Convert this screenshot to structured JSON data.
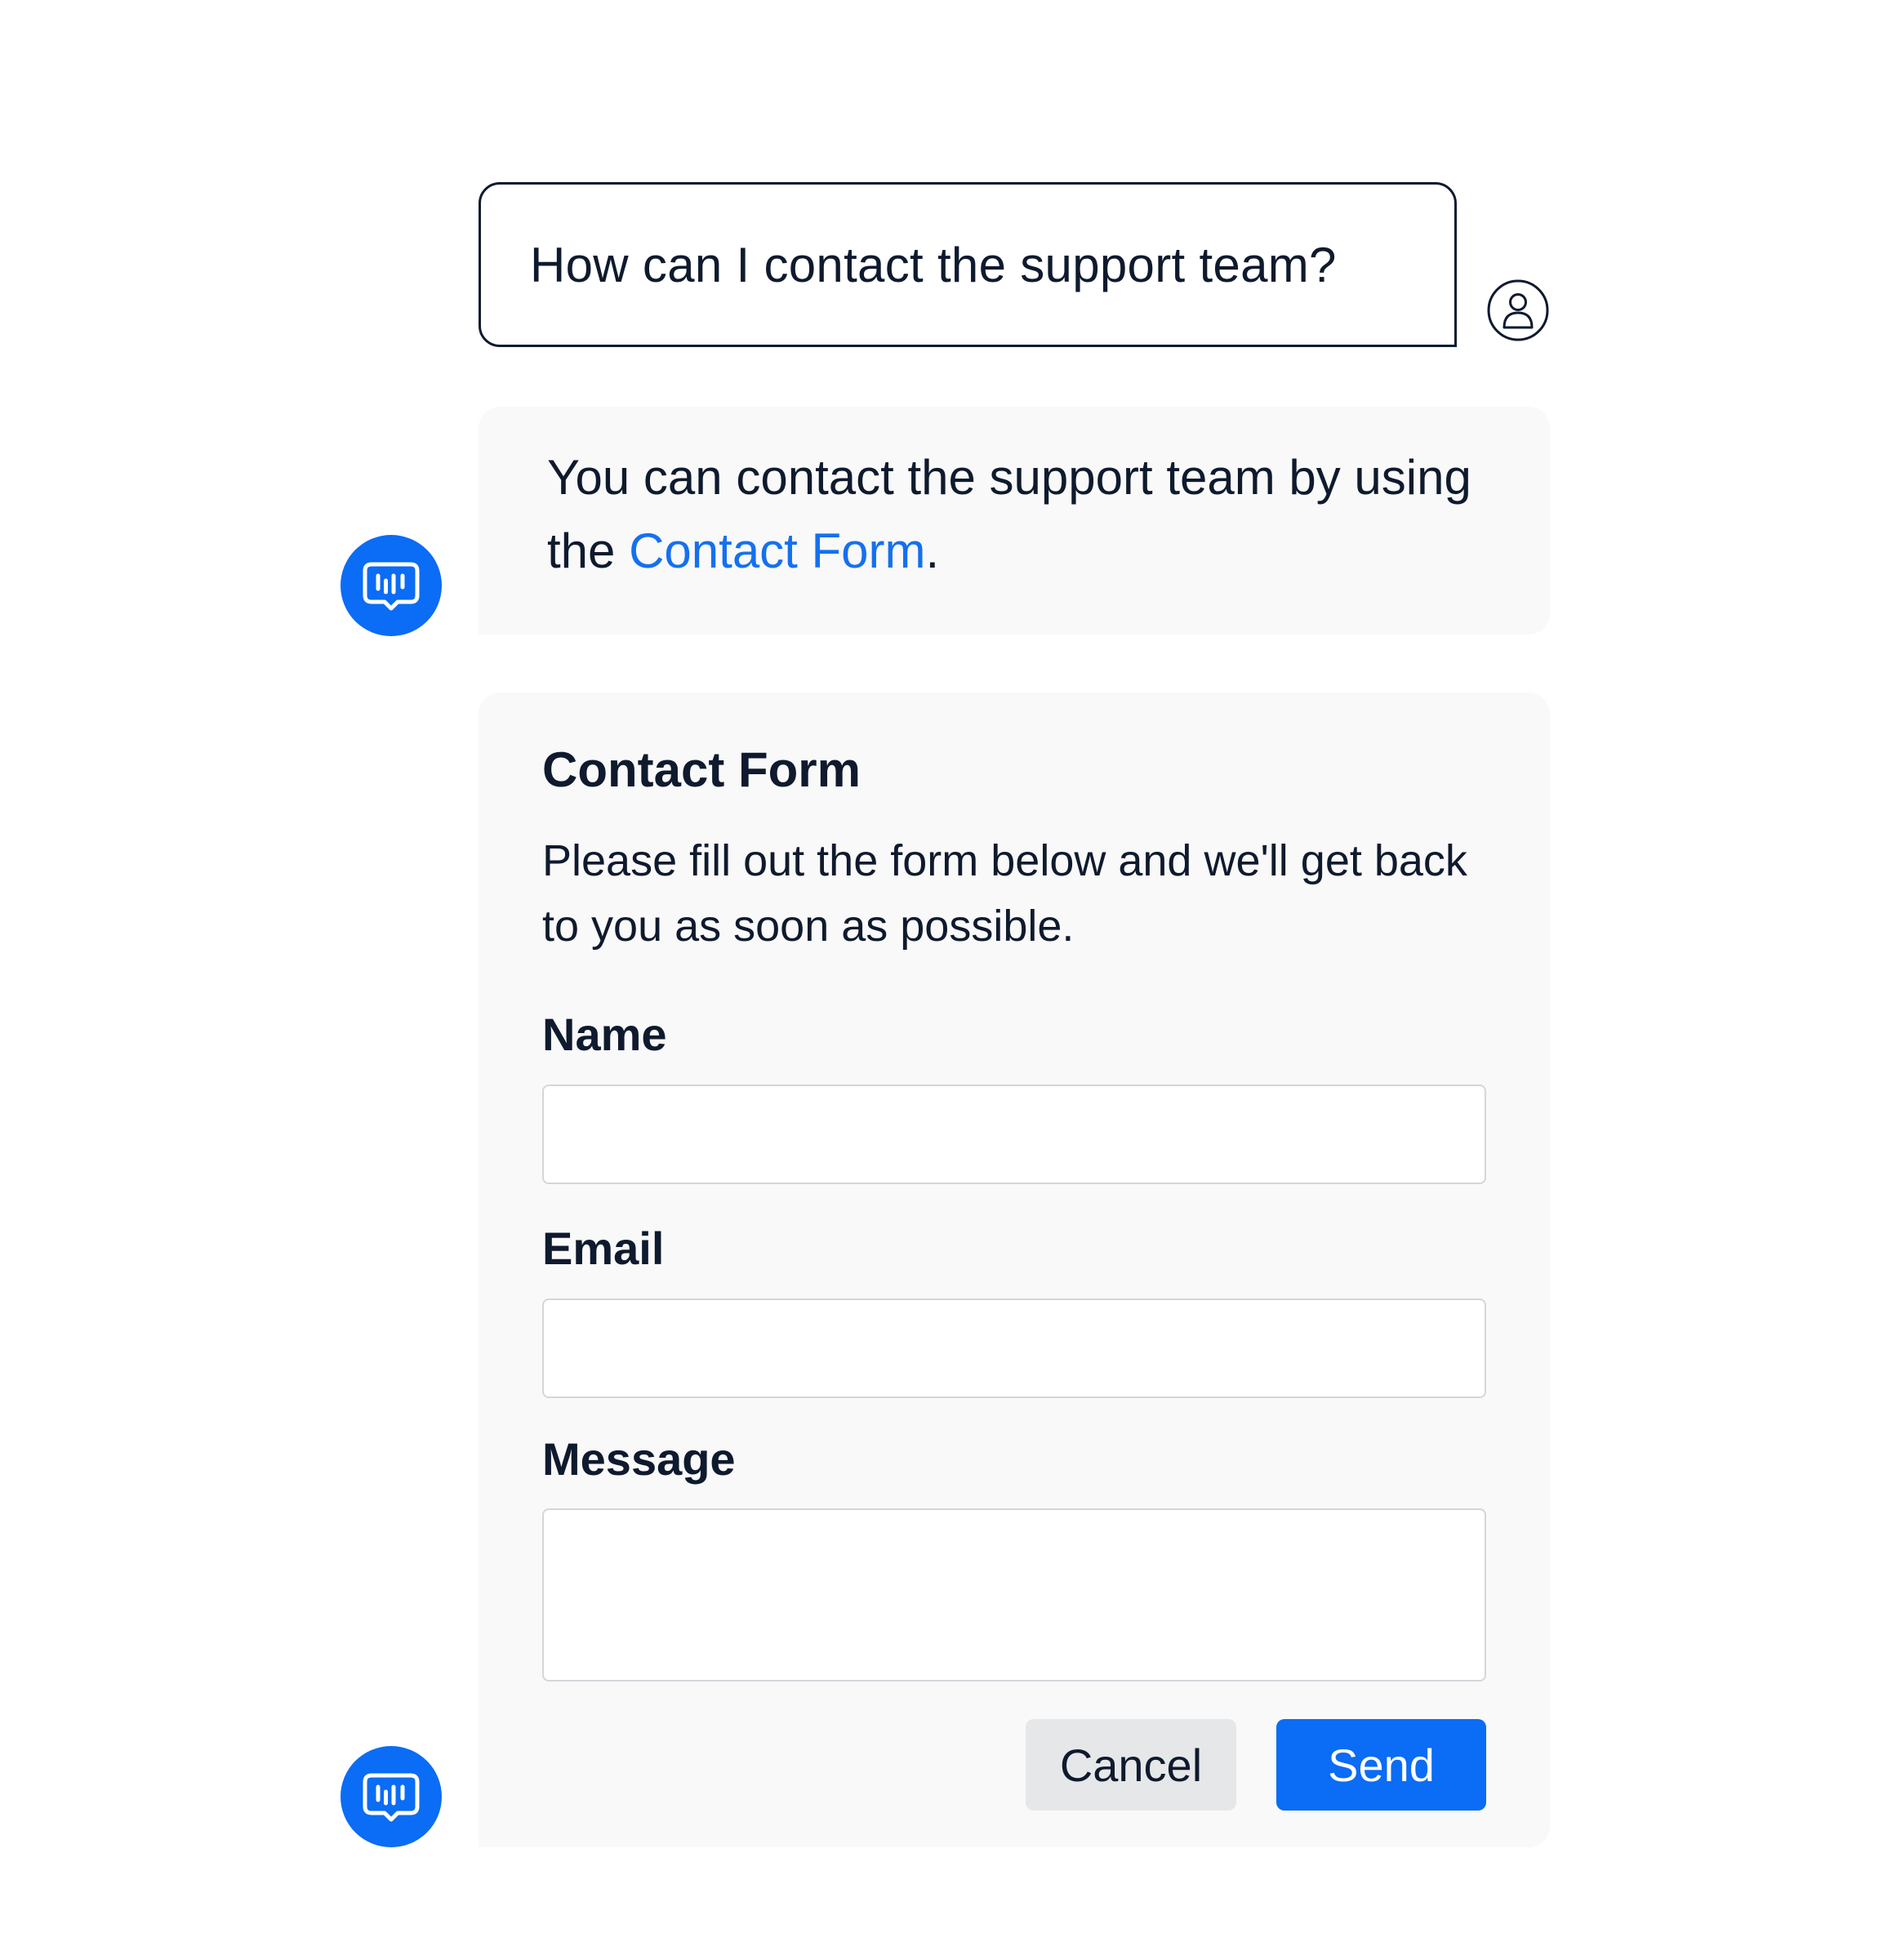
{
  "conversation": {
    "user_message": "How can I contact the support team?",
    "bot_reply": {
      "text_before": "You can contact the support team by using the ",
      "link_text": "Contact Form",
      "text_after": "."
    }
  },
  "contact_form": {
    "title": "Contact Form",
    "description": "Please fill out the form below and we'll get back to you as soon as possible.",
    "fields": {
      "name": {
        "label": "Name",
        "value": "",
        "placeholder": ""
      },
      "email": {
        "label": "Email",
        "value": "",
        "placeholder": ""
      },
      "message": {
        "label": "Message",
        "value": "",
        "placeholder": ""
      }
    },
    "cancel_label": "Cancel",
    "send_label": "Send"
  },
  "icons": {
    "user_avatar": "user-circle-icon",
    "bot_avatar": "chat-bot-icon"
  },
  "colors": {
    "accent": "#0b6cf5",
    "link": "#1570ef",
    "text": "#0f1a2e",
    "bubble_bg": "#f9f9f9",
    "cancel_bg": "#e6e7e9"
  }
}
